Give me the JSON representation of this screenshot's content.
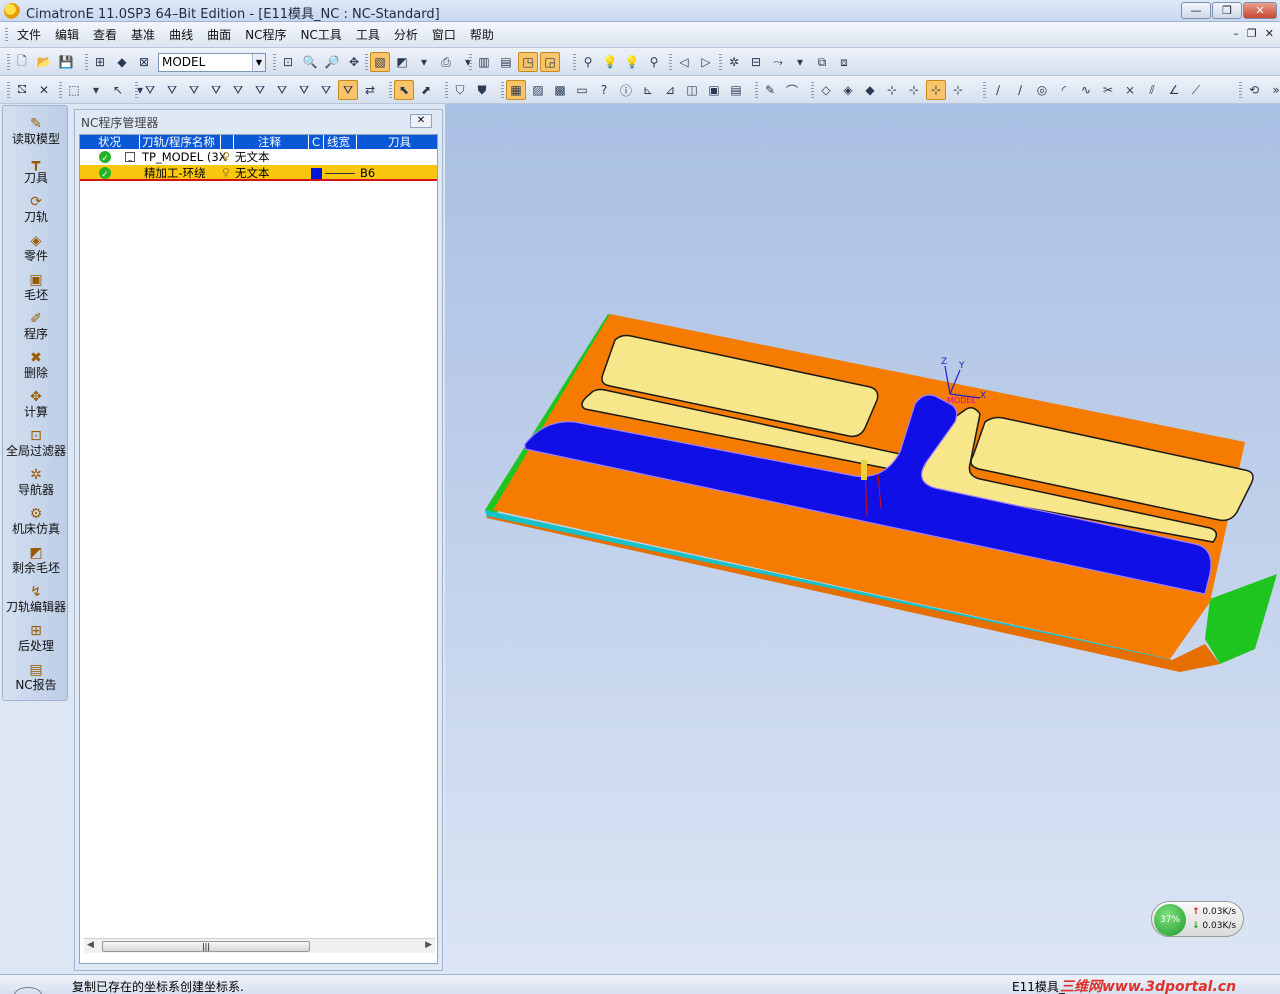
{
  "titlebar": {
    "title": "CimatronE 11.0SP3 64–Bit Edition - [E11模具_NC : NC-Standard]",
    "min": "—",
    "max": "❐",
    "close": "✕"
  },
  "menu": {
    "items": [
      "文件",
      "编辑",
      "查看",
      "基准",
      "曲线",
      "曲面",
      "NC程序",
      "NC工具",
      "工具",
      "分析",
      "窗口",
      "帮助"
    ],
    "mdi_min": "–",
    "mdi_restore": "❐",
    "mdi_close": "✕"
  },
  "toolbar1": {
    "model_combo": "MODEL",
    "combo_arrow": "▼"
  },
  "leftbar": {
    "items": [
      {
        "label": "读取模型",
        "icon": "✎"
      },
      {
        "label": "刀具",
        "icon": "┳"
      },
      {
        "label": "刀轨",
        "icon": "⟳"
      },
      {
        "label": "零件",
        "icon": "◈"
      },
      {
        "label": "毛坯",
        "icon": "▣"
      },
      {
        "label": "程序",
        "icon": "✐"
      },
      {
        "label": "删除",
        "icon": "✖"
      },
      {
        "label": "计算",
        "icon": "✥"
      },
      {
        "label": "全局过滤器",
        "icon": "⊡"
      },
      {
        "label": "导航器",
        "icon": "✲"
      },
      {
        "label": "机床仿真",
        "icon": "⚙"
      },
      {
        "label": "剩余毛坯",
        "icon": "◩"
      },
      {
        "label": "刀轨编辑器",
        "icon": "↯"
      },
      {
        "label": "后处理",
        "icon": "⊞"
      },
      {
        "label": "NC报告",
        "icon": "▤"
      }
    ]
  },
  "ncpanel": {
    "title": "NC程序管理器",
    "close": "✕",
    "columns": {
      "status": "状况",
      "name": "刀轨/程序名称",
      "comment": "注释",
      "c": "C",
      "linewidth": "线宽",
      "tool": "刀具"
    },
    "rows": [
      {
        "name": "TP_MODEL (3X",
        "comment": "无文本",
        "tool": ""
      },
      {
        "name": "精加工-环绕",
        "comment": "无文本",
        "tool": "B6"
      }
    ],
    "check": "✓",
    "expander": "–",
    "bulb": "♀",
    "scroll_left": "◀",
    "scroll_right": "▶",
    "scroll_thumb": "|||"
  },
  "viewport": {
    "axis_z": "Z",
    "axis_y": "Y",
    "axis_x": "X",
    "model_label": "MODEL",
    "colors": {
      "base_orange": "#f57c00",
      "pocket_yellow": "#f8e68a",
      "channel_blue": "#1010e6",
      "side_green": "#1ec51e",
      "edge_cyan": "#18c0c8"
    }
  },
  "netwidget": {
    "percent": "37%",
    "up": "0.03K/s",
    "down": "0.03K/s",
    "up_arrow": "↑",
    "down_arrow": "↓"
  },
  "statusbar": {
    "message": "复制已存在的坐标系创建坐标系.",
    "doc": "E11模具_",
    "watermark": "三维网www.3dportal.cn"
  }
}
